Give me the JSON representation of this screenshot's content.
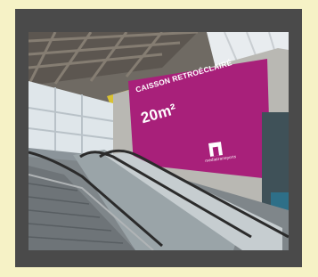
{
  "billboard": {
    "caption": "CAISSON RETROÉCLAIRÉ",
    "size": "20m²",
    "brand": "mediatransports",
    "color": "#a8207a"
  },
  "colors": {
    "page_background": "#f6f2c6",
    "card_background": "#4a4a4a"
  }
}
